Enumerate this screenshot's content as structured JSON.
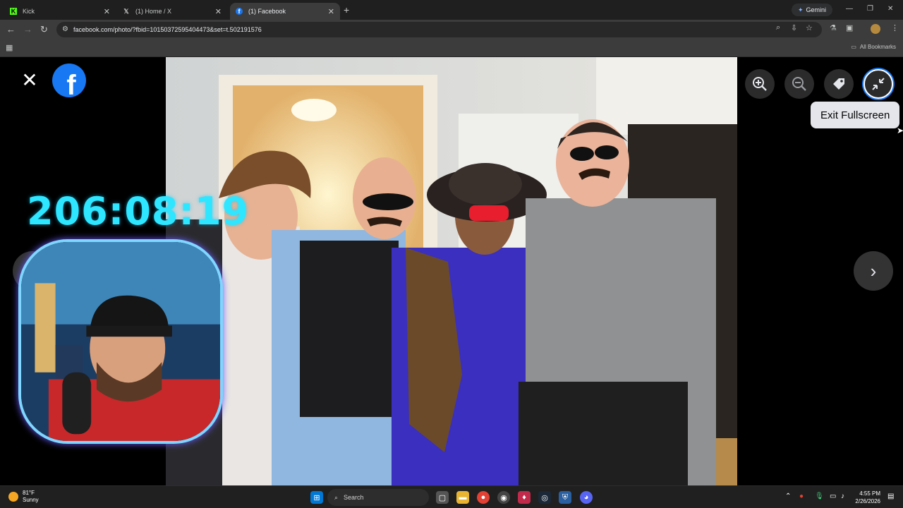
{
  "browser": {
    "tabs": [
      {
        "title": "Kick",
        "favicon": "K",
        "active": false
      },
      {
        "title": "(1) Home / X",
        "favicon": "X",
        "active": false
      },
      {
        "title": "(1) Facebook",
        "favicon": "f",
        "active": true
      }
    ],
    "gemini_label": "Gemini",
    "url": "facebook.com/photo/?fbid=10150372595404473&set=t.502191576",
    "all_bookmarks": "All Bookmarks"
  },
  "viewer": {
    "tooltip": "Exit Fullscreen",
    "tools": [
      "zoom-in",
      "zoom-out",
      "tag",
      "exit-fullscreen"
    ]
  },
  "overlay": {
    "timer": "206:08:19"
  },
  "taskbar": {
    "weather_temp": "81°F",
    "weather_desc": "Sunny",
    "search_placeholder": "Search",
    "time": "4:55 PM",
    "date": "2/26/2026"
  },
  "colors": {
    "facebook_blue": "#1877f2",
    "timer_cyan": "#2ee6ff",
    "chrome_dark": "#3c3c3c"
  }
}
